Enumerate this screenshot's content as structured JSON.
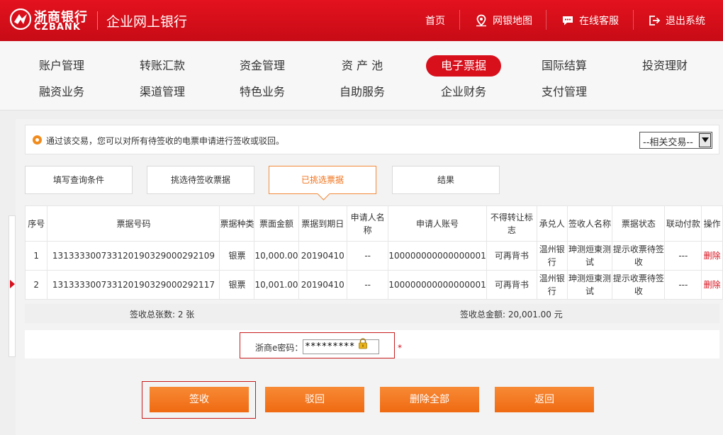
{
  "header": {
    "logo_cn": "浙商银行",
    "logo_en": "CZBANK",
    "site_title": "企业网上银行",
    "links": {
      "home": "首页",
      "map": "网银地图",
      "service": "在线客服",
      "logout": "退出系统"
    }
  },
  "mainnav": {
    "account": "账户管理",
    "transfer": "转账汇款",
    "funds": "资金管理",
    "pool": "资 产 池",
    "ebill": "电子票据",
    "intl": "国际结算",
    "invest": "投资理财",
    "financing": "融资业务",
    "channel": "渠道管理",
    "special": "特色业务",
    "self": "自助服务",
    "corp_finance": "企业财务",
    "payment": "支付管理"
  },
  "tip": {
    "text": "通过该交易，您可以对所有待签收的电票申请进行签收或驳回。",
    "related_select": "--相关交易--"
  },
  "steps": {
    "step1": "填写查询条件",
    "step2": "挑选待签收票据",
    "step3": "已挑选票据",
    "step4": "结果"
  },
  "table": {
    "headers": {
      "seq": "序号",
      "bill_no": "票据号码",
      "bill_type": "票据种类",
      "amount": "票面金额",
      "due_date": "票据到期日",
      "applicant_name": "申请人名称",
      "applicant_account": "申请人账号",
      "no_transfer": "不得转让标志",
      "acceptor": "承兑人",
      "receiver_name": "签收人名称",
      "status": "票据状态",
      "linked_pay": "联动付款",
      "action": "操作"
    },
    "rows": [
      {
        "seq": "1",
        "bill_no": "131333300733120190329000292109",
        "bill_type": "银票",
        "amount": "10,000.00",
        "due_date": "20190410",
        "applicant_name": "--",
        "applicant_account": "100000000000000001",
        "no_transfer": "可再背书",
        "acceptor": "温州银行",
        "receiver_name": "珅测烜東测试",
        "status": "提示收票待签收",
        "linked_pay": "---",
        "action": "删除"
      },
      {
        "seq": "2",
        "bill_no": "131333300733120190329000292117",
        "bill_type": "银票",
        "amount": "10,001.00",
        "due_date": "20190410",
        "applicant_name": "--",
        "applicant_account": "100000000000000001",
        "no_transfer": "可再背书",
        "acceptor": "温州银行",
        "receiver_name": "珅测烜東测试",
        "status": "提示收票待签收",
        "linked_pay": "---",
        "action": "删除"
      }
    ]
  },
  "summary": {
    "count": "签收总张数: 2 张",
    "total": "签收总金额: 20,001.00 元"
  },
  "password": {
    "label": "浙商e密码：",
    "value": "*********",
    "required_mark": "*"
  },
  "buttons": {
    "sign": "签收",
    "reject": "驳回",
    "delete_all": "删除全部",
    "back": "返回"
  },
  "colors": {
    "brand_red": "#d7101c",
    "accent_orange": "#f07118"
  }
}
